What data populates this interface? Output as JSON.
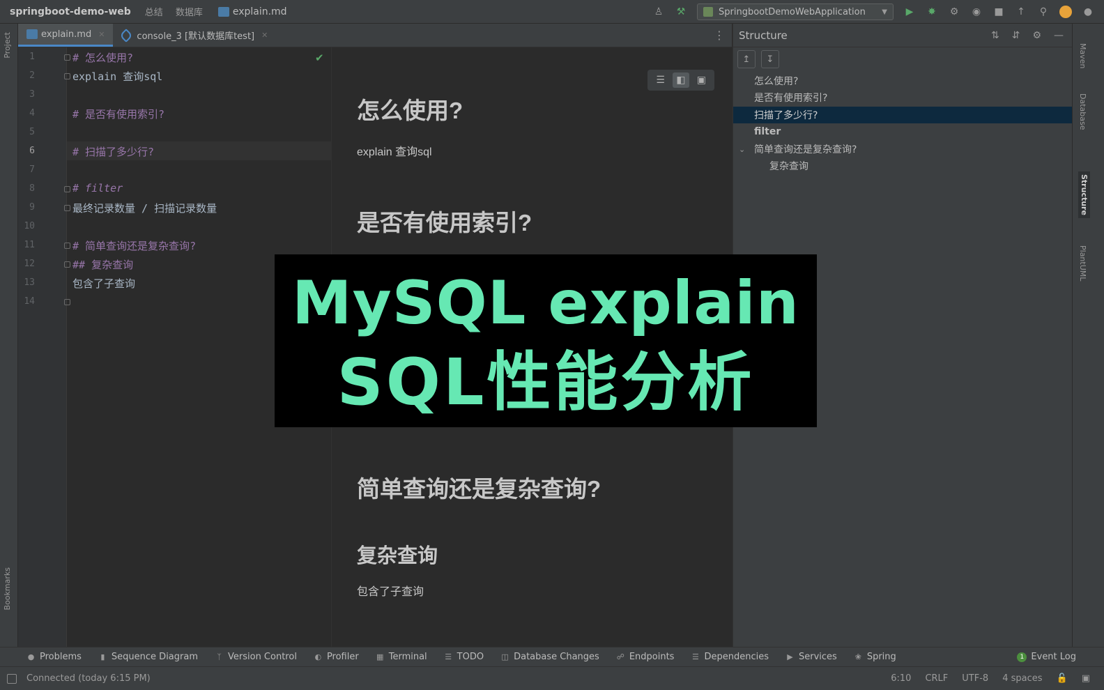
{
  "topbar": {
    "project": "springboot-demo-web",
    "crumb_1": "总结",
    "crumb_2": "数据库",
    "file": "explain.md",
    "run_config": "SpringbootDemoWebApplication"
  },
  "tabs": [
    {
      "label": "explain.md",
      "active": true
    },
    {
      "label": "console_3 [默认数据库test]",
      "active": false
    }
  ],
  "left_stripe": {
    "project": "Project",
    "bookmarks": "Bookmarks"
  },
  "editor": {
    "line_numbers": [
      "1",
      "2",
      "3",
      "4",
      "5",
      "6",
      "7",
      "8",
      "9",
      "10",
      "11",
      "12",
      "13",
      "14"
    ],
    "current_line": "6",
    "lines": [
      "# 怎么使用?",
      "explain 查询sql",
      "",
      "# 是否有使用索引?",
      "",
      "# 扫描了多少行?",
      "",
      "# filter",
      "最终记录数量 / 扫描记录数量",
      "",
      "# 简单查询还是复杂查询?",
      "## 复杂查询",
      "包含了子查询",
      ""
    ]
  },
  "preview": {
    "h1_usage": "怎么使用?",
    "p_usage": "explain 查询sql",
    "h1_index": "是否有使用索引?",
    "h1_simple": "简单查询还是复杂查询?",
    "h2_complex": "复杂查询",
    "p_complex": "包含了子查询"
  },
  "structure": {
    "title": "Structure",
    "items": [
      {
        "label": "怎么使用?",
        "selected": false
      },
      {
        "label": "是否有使用索引?",
        "selected": false
      },
      {
        "label": "扫描了多少行?",
        "selected": true
      },
      {
        "label": "filter",
        "selected": false
      },
      {
        "label": "简单查询还是复杂查询?",
        "selected": false,
        "expanded": true
      },
      {
        "label": "复杂查询",
        "selected": false,
        "child": true
      }
    ]
  },
  "right_stripe": {
    "maven": "Maven",
    "database": "Database",
    "structure": "Structure",
    "plantuml": "PlantUML"
  },
  "bottom_tools": {
    "problems": "Problems",
    "sequence": "Sequence Diagram",
    "vcs": "Version Control",
    "profiler": "Profiler",
    "terminal": "Terminal",
    "todo": "TODO",
    "db_changes": "Database Changes",
    "endpoints": "Endpoints",
    "dependencies": "Dependencies",
    "services": "Services",
    "spring": "Spring",
    "event_log": "Event Log",
    "event_count": "1"
  },
  "status": {
    "message": "Connected (today 6:15 PM)",
    "position": "6:10",
    "line_sep": "CRLF",
    "encoding": "UTF-8",
    "indent": "4 spaces"
  },
  "overlay": {
    "line1": "MySQL explain",
    "line2": "SQL性能分析"
  },
  "colors": {
    "overlay_text": "#66e8b3",
    "heading_purple": "#9876aa",
    "selection": "#0d293e",
    "accent_tab": "#4a88c7"
  }
}
